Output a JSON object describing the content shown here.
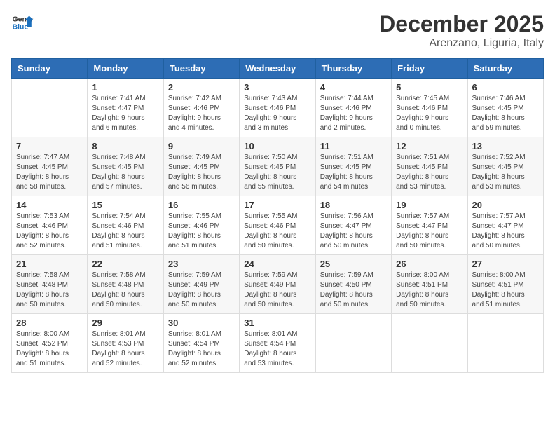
{
  "header": {
    "logo_line1": "General",
    "logo_line2": "Blue",
    "month_year": "December 2025",
    "location": "Arenzano, Liguria, Italy"
  },
  "weekdays": [
    "Sunday",
    "Monday",
    "Tuesday",
    "Wednesday",
    "Thursday",
    "Friday",
    "Saturday"
  ],
  "weeks": [
    [
      {
        "day": "",
        "detail": ""
      },
      {
        "day": "1",
        "detail": "Sunrise: 7:41 AM\nSunset: 4:47 PM\nDaylight: 9 hours\nand 6 minutes."
      },
      {
        "day": "2",
        "detail": "Sunrise: 7:42 AM\nSunset: 4:46 PM\nDaylight: 9 hours\nand 4 minutes."
      },
      {
        "day": "3",
        "detail": "Sunrise: 7:43 AM\nSunset: 4:46 PM\nDaylight: 9 hours\nand 3 minutes."
      },
      {
        "day": "4",
        "detail": "Sunrise: 7:44 AM\nSunset: 4:46 PM\nDaylight: 9 hours\nand 2 minutes."
      },
      {
        "day": "5",
        "detail": "Sunrise: 7:45 AM\nSunset: 4:46 PM\nDaylight: 9 hours\nand 0 minutes."
      },
      {
        "day": "6",
        "detail": "Sunrise: 7:46 AM\nSunset: 4:45 PM\nDaylight: 8 hours\nand 59 minutes."
      }
    ],
    [
      {
        "day": "7",
        "detail": "Sunrise: 7:47 AM\nSunset: 4:45 PM\nDaylight: 8 hours\nand 58 minutes."
      },
      {
        "day": "8",
        "detail": "Sunrise: 7:48 AM\nSunset: 4:45 PM\nDaylight: 8 hours\nand 57 minutes."
      },
      {
        "day": "9",
        "detail": "Sunrise: 7:49 AM\nSunset: 4:45 PM\nDaylight: 8 hours\nand 56 minutes."
      },
      {
        "day": "10",
        "detail": "Sunrise: 7:50 AM\nSunset: 4:45 PM\nDaylight: 8 hours\nand 55 minutes."
      },
      {
        "day": "11",
        "detail": "Sunrise: 7:51 AM\nSunset: 4:45 PM\nDaylight: 8 hours\nand 54 minutes."
      },
      {
        "day": "12",
        "detail": "Sunrise: 7:51 AM\nSunset: 4:45 PM\nDaylight: 8 hours\nand 53 minutes."
      },
      {
        "day": "13",
        "detail": "Sunrise: 7:52 AM\nSunset: 4:45 PM\nDaylight: 8 hours\nand 53 minutes."
      }
    ],
    [
      {
        "day": "14",
        "detail": "Sunrise: 7:53 AM\nSunset: 4:46 PM\nDaylight: 8 hours\nand 52 minutes."
      },
      {
        "day": "15",
        "detail": "Sunrise: 7:54 AM\nSunset: 4:46 PM\nDaylight: 8 hours\nand 51 minutes."
      },
      {
        "day": "16",
        "detail": "Sunrise: 7:55 AM\nSunset: 4:46 PM\nDaylight: 8 hours\nand 51 minutes."
      },
      {
        "day": "17",
        "detail": "Sunrise: 7:55 AM\nSunset: 4:46 PM\nDaylight: 8 hours\nand 50 minutes."
      },
      {
        "day": "18",
        "detail": "Sunrise: 7:56 AM\nSunset: 4:47 PM\nDaylight: 8 hours\nand 50 minutes."
      },
      {
        "day": "19",
        "detail": "Sunrise: 7:57 AM\nSunset: 4:47 PM\nDaylight: 8 hours\nand 50 minutes."
      },
      {
        "day": "20",
        "detail": "Sunrise: 7:57 AM\nSunset: 4:47 PM\nDaylight: 8 hours\nand 50 minutes."
      }
    ],
    [
      {
        "day": "21",
        "detail": "Sunrise: 7:58 AM\nSunset: 4:48 PM\nDaylight: 8 hours\nand 50 minutes."
      },
      {
        "day": "22",
        "detail": "Sunrise: 7:58 AM\nSunset: 4:48 PM\nDaylight: 8 hours\nand 50 minutes."
      },
      {
        "day": "23",
        "detail": "Sunrise: 7:59 AM\nSunset: 4:49 PM\nDaylight: 8 hours\nand 50 minutes."
      },
      {
        "day": "24",
        "detail": "Sunrise: 7:59 AM\nSunset: 4:49 PM\nDaylight: 8 hours\nand 50 minutes."
      },
      {
        "day": "25",
        "detail": "Sunrise: 7:59 AM\nSunset: 4:50 PM\nDaylight: 8 hours\nand 50 minutes."
      },
      {
        "day": "26",
        "detail": "Sunrise: 8:00 AM\nSunset: 4:51 PM\nDaylight: 8 hours\nand 50 minutes."
      },
      {
        "day": "27",
        "detail": "Sunrise: 8:00 AM\nSunset: 4:51 PM\nDaylight: 8 hours\nand 51 minutes."
      }
    ],
    [
      {
        "day": "28",
        "detail": "Sunrise: 8:00 AM\nSunset: 4:52 PM\nDaylight: 8 hours\nand 51 minutes."
      },
      {
        "day": "29",
        "detail": "Sunrise: 8:01 AM\nSunset: 4:53 PM\nDaylight: 8 hours\nand 52 minutes."
      },
      {
        "day": "30",
        "detail": "Sunrise: 8:01 AM\nSunset: 4:54 PM\nDaylight: 8 hours\nand 52 minutes."
      },
      {
        "day": "31",
        "detail": "Sunrise: 8:01 AM\nSunset: 4:54 PM\nDaylight: 8 hours\nand 53 minutes."
      },
      {
        "day": "",
        "detail": ""
      },
      {
        "day": "",
        "detail": ""
      },
      {
        "day": "",
        "detail": ""
      }
    ]
  ]
}
